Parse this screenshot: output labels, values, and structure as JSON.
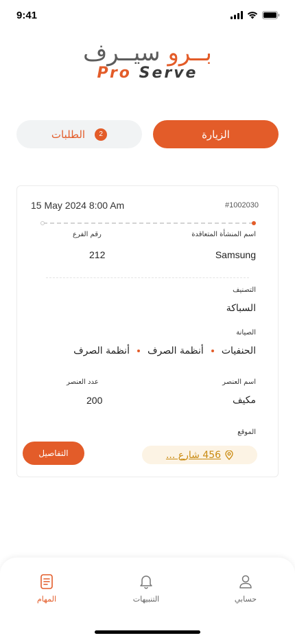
{
  "status_bar": {
    "time": "9:41"
  },
  "logo": {
    "arabic_main": "سيــرف",
    "arabic_accent": "بــرو",
    "english_accent": "Pro",
    "english_main": "Serve"
  },
  "tabs": {
    "visit_label": "الزيارة",
    "requests_label": "الطلبات",
    "requests_count": "2"
  },
  "card": {
    "date": "15 May 2024 8:00 Am",
    "order_id": "#1002030",
    "facility_label": "اسم المنشأة المتعاقدة",
    "facility_value": "Samsung",
    "branch_label": "رقم الفرع",
    "branch_value": "212",
    "category_label": "التصنيف",
    "category_value": "السباكة",
    "maintenance_label": "الصيانة",
    "maintenance_items": [
      "الحنفيات",
      "أنظمة الصرف",
      "أنظمة الصرف"
    ],
    "item_name_label": "اسم العنصر",
    "item_name_value": "مكيف",
    "item_count_label": "عدد العنصر",
    "item_count_value": "200",
    "location_label": "الموقع",
    "location_value": "456 شارع ...",
    "details_button": "التفاصيل"
  },
  "bottom_nav": {
    "items": [
      {
        "label": "المهام",
        "icon": "document-icon",
        "active": true
      },
      {
        "label": "التنبيهات",
        "icon": "bell-icon",
        "active": false
      },
      {
        "label": "حسابي",
        "icon": "user-icon",
        "active": false
      }
    ]
  },
  "colors": {
    "accent": "#e35c29",
    "location_text": "#c98a10",
    "location_bg": "#fcf3e4"
  }
}
